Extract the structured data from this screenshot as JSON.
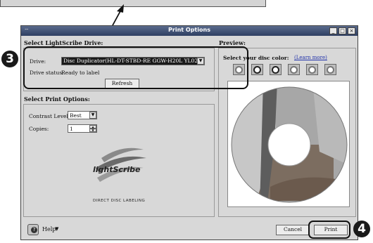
{
  "window": {
    "title": "Print Options",
    "min_label": "_",
    "max_label": "□",
    "close_label": "×"
  },
  "drive_section": {
    "heading": "Select LightScribe Drive:",
    "drive_label": "Drive:",
    "drive_value": "Disc Duplicator(HL-DT-STBD-RE  GGW-H20L YL02",
    "status_label": "Drive status:",
    "status_value": "Ready to label",
    "refresh_label": "Refresh"
  },
  "print_section": {
    "heading": "Select Print Options:",
    "contrast_label": "Contrast Level:",
    "contrast_value": "Best",
    "copies_label": "Copies:",
    "copies_value": "1"
  },
  "logo": {
    "brand": "lightScribe",
    "tagline": "DIRECT DISC LABELING"
  },
  "preview": {
    "heading": "Preview:",
    "color_label": "Select your disc color:",
    "learn_more": "(Learn more)",
    "swatches": [
      {
        "name": "gray",
        "dark": false
      },
      {
        "name": "black",
        "dark": true
      },
      {
        "name": "black",
        "dark": true
      },
      {
        "name": "gray",
        "dark": false
      },
      {
        "name": "gray",
        "dark": false
      },
      {
        "name": "gray",
        "dark": false
      }
    ]
  },
  "footer": {
    "help_label": "Help",
    "cancel_label": "Cancel",
    "print_label": "Print"
  },
  "callouts": {
    "step3": "3",
    "step4": "4"
  }
}
